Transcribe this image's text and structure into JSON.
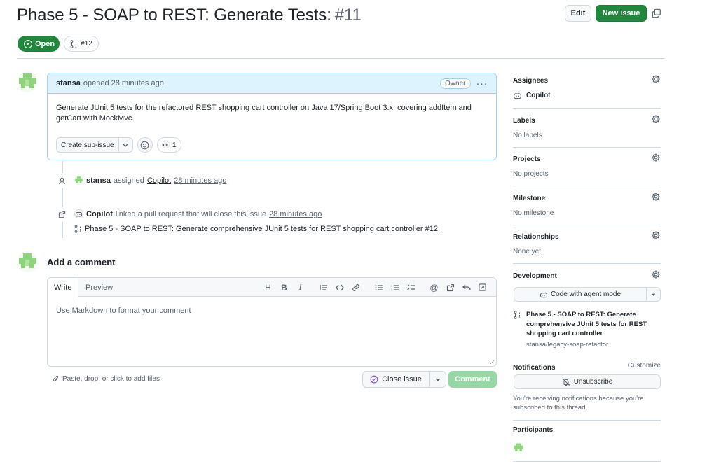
{
  "issue": {
    "title": "Phase 5 - SOAP to REST: Generate Tests:",
    "number": "#11",
    "state": "Open",
    "linked_pr_badge": "#12"
  },
  "header": {
    "edit_label": "Edit",
    "new_issue_label": "New issue"
  },
  "comment": {
    "author": "stansa",
    "meta": "opened 28 minutes ago",
    "owner_label": "Owner",
    "body": "Generate JUnit 5 tests for the refactored REST shopping cart controller on Java 17/Spring Boot 3.x, covering addItem and getCart with MockMvc.",
    "create_sub_issue_label": "Create sub-issue",
    "reaction_emoji": "👀",
    "reaction_count": "1"
  },
  "timeline": [
    {
      "actor": "stansa",
      "action": "assigned",
      "target": "Copilot",
      "time": "28 minutes ago"
    },
    {
      "actor": "Copilot",
      "action": "linked a pull request that will close this issue",
      "time": "28 minutes ago",
      "pr_title": "Phase 5 - SOAP to REST: Generate comprehensive JUnit 5 tests for REST shopping cart controller #12"
    }
  ],
  "composer": {
    "title": "Add a comment",
    "tab_write": "Write",
    "tab_preview": "Preview",
    "placeholder": "Use Markdown to format your comment",
    "attach_hint": "Paste, drop, or click to add files",
    "close_issue_label": "Close issue",
    "comment_label": "Comment"
  },
  "sidebar": {
    "assignees": {
      "heading": "Assignees",
      "value": "Copilot"
    },
    "labels": {
      "heading": "Labels",
      "value": "No labels"
    },
    "projects": {
      "heading": "Projects",
      "value": "No projects"
    },
    "milestone": {
      "heading": "Milestone",
      "value": "No milestone"
    },
    "relationships": {
      "heading": "Relationships",
      "value": "None yet"
    },
    "development": {
      "heading": "Development",
      "agent_button": "Code with agent mode",
      "pr_title": "Phase 5 - SOAP to REST: Generate comprehensive JUnit 5 tests for REST shopping cart controller",
      "repo": "stansa/legacy-soap-refactor"
    },
    "notifications": {
      "heading": "Notifications",
      "customize_label": "Customize",
      "unsubscribe_label": "Unsubscribe",
      "reason": "You're receiving notifications because you're subscribed to this thread."
    },
    "participants": {
      "heading": "Participants"
    }
  },
  "colors": {
    "primary_green": "#1f883d",
    "comment_header_bg": "#ddf4ff",
    "border": "#d1d9e0",
    "muted_text": "#59636e"
  }
}
